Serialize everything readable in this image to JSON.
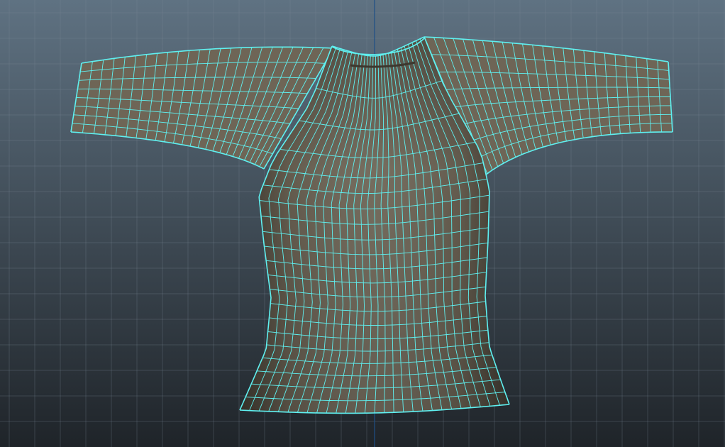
{
  "viewport": {
    "background_top": "#5f7282",
    "background_bottom": "#1f2429",
    "grid_color": "#7d8d9b",
    "axis_color": "#1e4f86"
  },
  "model": {
    "object": "t-shirt",
    "display_mode": "wireframe-on-shaded",
    "fabric_color": "#6e6556",
    "fabric_shadow": "#3c382f",
    "wire_color": "#5ff0f0",
    "columns": 28,
    "rows": 21
  }
}
